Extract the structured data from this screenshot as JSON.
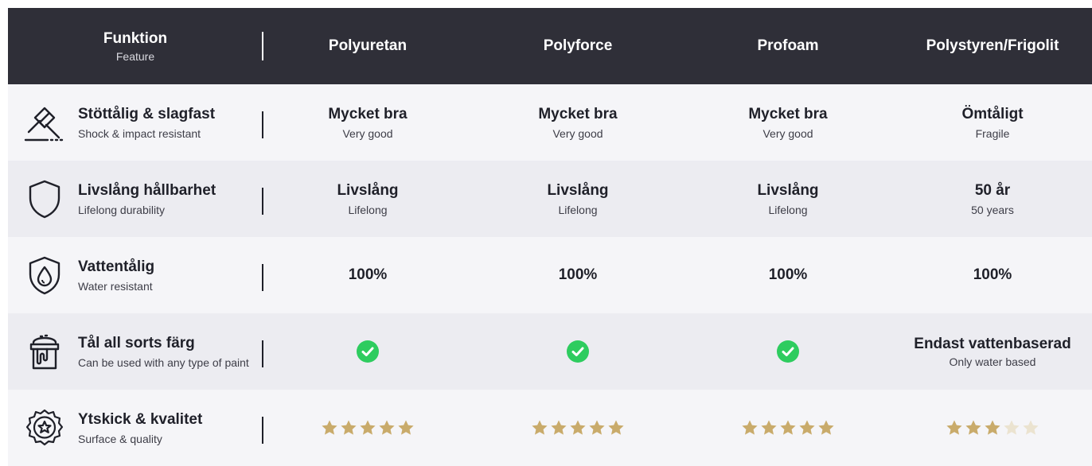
{
  "header": {
    "feature_title": "Funktion",
    "feature_subtitle": "Feature",
    "columns": [
      "Polyuretan",
      "Polyforce",
      "Profoam",
      "Polystyren/Frigolit"
    ]
  },
  "rows": [
    {
      "icon": "gavel-icon",
      "title": "Stöttålig & slagfast",
      "subtitle": "Shock & impact resistant",
      "values": [
        {
          "t": "Mycket bra",
          "s": "Very good"
        },
        {
          "t": "Mycket bra",
          "s": "Very good"
        },
        {
          "t": "Mycket bra",
          "s": "Very good"
        },
        {
          "t": "Ömtåligt",
          "s": "Fragile"
        }
      ]
    },
    {
      "icon": "shield-icon",
      "title": "Livslång hållbarhet",
      "subtitle": "Lifelong durability",
      "values": [
        {
          "t": "Livslång",
          "s": "Lifelong"
        },
        {
          "t": "Livslång",
          "s": "Lifelong"
        },
        {
          "t": "Livslång",
          "s": "Lifelong"
        },
        {
          "t": "50 år",
          "s": "50 years"
        }
      ]
    },
    {
      "icon": "water-drop-shield-icon",
      "title": "Vattentålig",
      "subtitle": "Water resistant",
      "values": [
        {
          "t": "100%"
        },
        {
          "t": "100%"
        },
        {
          "t": "100%"
        },
        {
          "t": "100%"
        }
      ]
    },
    {
      "icon": "paint-bucket-icon",
      "title": "Tål all sorts färg",
      "subtitle": "Can be used with any type of paint",
      "values": [
        {
          "check": true
        },
        {
          "check": true
        },
        {
          "check": true
        },
        {
          "t": "Endast vattenbaserad",
          "s": "Only water based"
        }
      ]
    },
    {
      "icon": "quality-badge-icon",
      "title": "Ytskick & kvalitet",
      "subtitle": "Surface & quality",
      "ratings": [
        5,
        5,
        5,
        3
      ],
      "rating_max": 5
    }
  ],
  "colors": {
    "header_bg": "#2f2f38",
    "check_green": "#2ecc5f",
    "star_gold": "#c9ab6b",
    "star_empty": "#ebe3d0"
  }
}
